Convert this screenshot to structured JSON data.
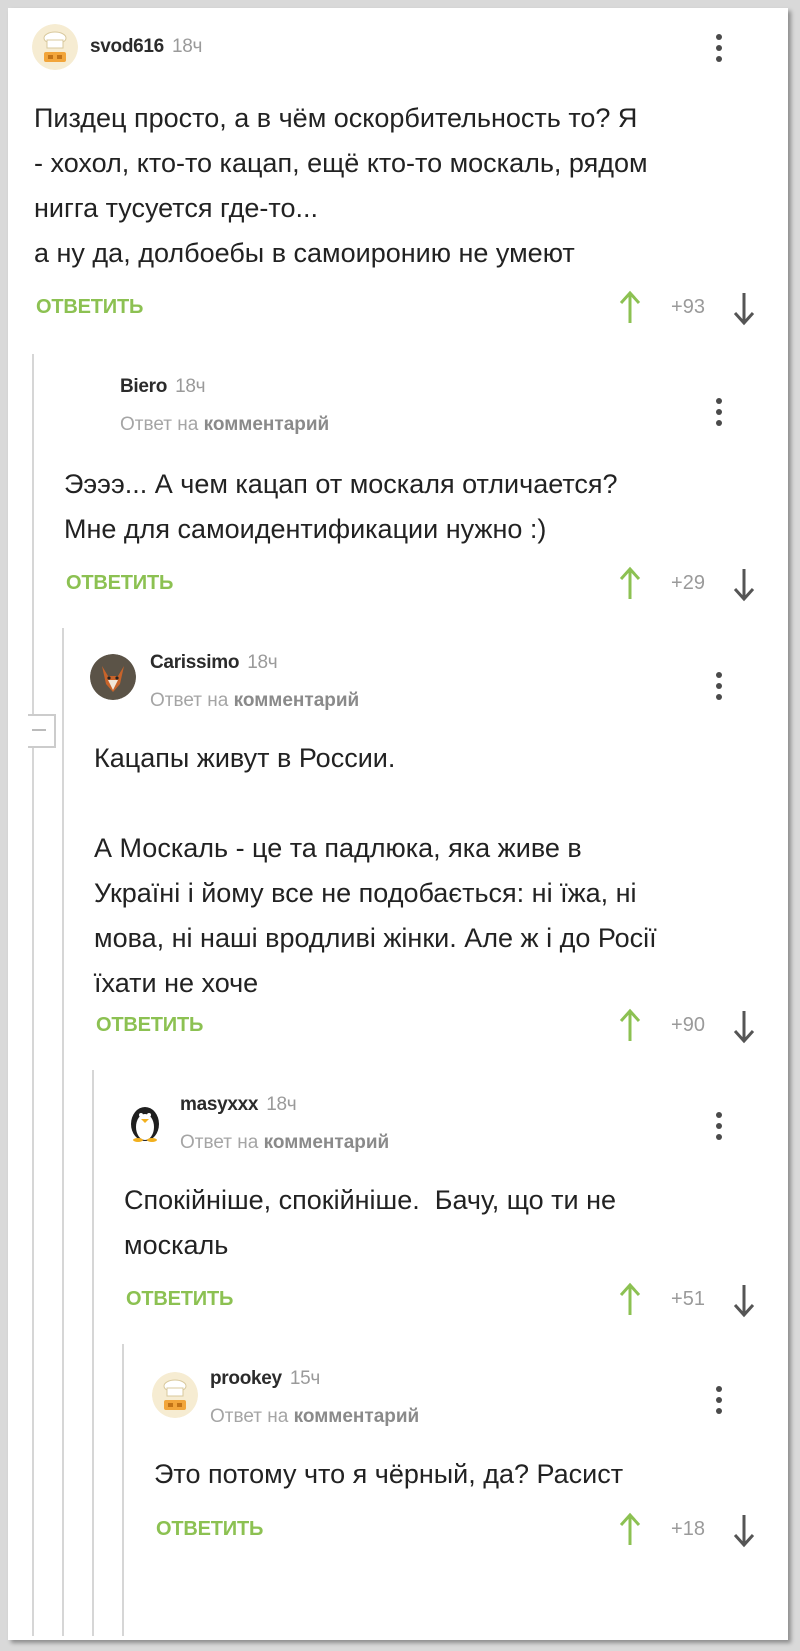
{
  "colors": {
    "accent_green": "#8cc152",
    "text": "#222222",
    "muted": "#9a9a9a"
  },
  "comments": [
    {
      "username": "svod616",
      "time": "18ч",
      "avatar_icon": "chef-hat-avatar-icon",
      "text": "Пиздец просто, а в чём оскорбительность то? Я\n- хохол, кто-то кацап, ещё кто-то москаль, рядом\nнигга тусуется где-то...\nа ну да, долбоебы в самоиронию не умеют",
      "reply_label": "ответить",
      "score": "+93"
    },
    {
      "username": "Biero",
      "time": "18ч",
      "reply_prefix": "Ответ на",
      "reply_target": "комментарий",
      "text": "Ээээ... А чем кацап от москаля отличается?\nМне для самоидентификации нужно :)",
      "reply_label": "ответить",
      "score": "+29"
    },
    {
      "username": "Carissimo",
      "time": "18ч",
      "avatar_icon": "fox-avatar-icon",
      "reply_prefix": "Ответ на",
      "reply_target": "комментарий",
      "text": "Кацапы живут в России.\n\nА Москаль - це та падлюка, яка живе в\nУкраїні і йому все не подобається: ні їжа, ні\nмова, ні наші вродливі жінки. Але ж і до Росії\nїхати не хоче",
      "reply_label": "ответить",
      "score": "+90"
    },
    {
      "username": "masyxxx",
      "time": "18ч",
      "avatar_icon": "penguin-avatar-icon",
      "reply_prefix": "Ответ на",
      "reply_target": "комментарий",
      "text": "Спокійніше, спокійніше.  Бачу, що ти не\nмоскаль",
      "reply_label": "ответить",
      "score": "+51"
    },
    {
      "username": "prookey",
      "time": "15ч",
      "avatar_icon": "chef-hat-avatar-icon",
      "reply_prefix": "Ответ на",
      "reply_target": "комментарий",
      "text": "Это потому что я чёрный, да? Расист",
      "reply_label": "ответить",
      "score": "+18"
    }
  ]
}
